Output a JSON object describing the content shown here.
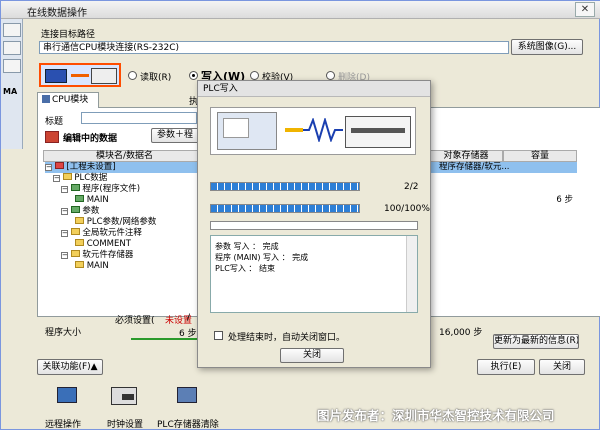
{
  "window": {
    "title": "在线数据操作"
  },
  "left_strip": {
    "label": "MA"
  },
  "connection": {
    "label": "连接目标路径",
    "value": "串行通信CPU模块连接(RS-232C)",
    "button": "系统图像(G)..."
  },
  "modes": [
    {
      "label": "读取(R)",
      "selected": false
    },
    {
      "label": "写入(W)",
      "selected": true
    },
    {
      "label": "校验(V)",
      "selected": false
    },
    {
      "label": "删除(D)",
      "selected": false
    }
  ],
  "tab": {
    "label": "CPU模块",
    "partial_label": "执"
  },
  "title_field": {
    "label": "标题"
  },
  "editing": {
    "label": "编辑中的数据",
    "param_button": "参数＋程"
  },
  "tree": {
    "header": "模块名/数据名",
    "rows": [
      {
        "label": "[工程未设置]",
        "indent": 0,
        "selected": true
      },
      {
        "label": "PLC数据",
        "indent": 1,
        "selected": false
      },
      {
        "label": "程序(程序文件)",
        "indent": 2,
        "selected": false
      },
      {
        "label": "MAIN",
        "indent": 3,
        "selected": false
      },
      {
        "label": "参数",
        "indent": 2,
        "selected": false
      },
      {
        "label": "PLC参数/网络参数",
        "indent": 3,
        "selected": false
      },
      {
        "label": "全局软元件注释",
        "indent": 2,
        "selected": false
      },
      {
        "label": "COMMENT",
        "indent": 3,
        "selected": false
      },
      {
        "label": "软元件存储器",
        "indent": 2,
        "selected": false
      },
      {
        "label": "MAIN",
        "indent": 3,
        "selected": false
      }
    ]
  },
  "right_table": {
    "col1": "对象存储器",
    "col2": "容量",
    "row_memory": "程序存储器/软元...",
    "row_capacity": "6 步"
  },
  "footer": {
    "required_label": "必须设置(",
    "unset_text": "未设置",
    "slash": "/",
    "program_size_label": "程序大小",
    "program_size_value": "6 步",
    "total_steps": "16,000 步",
    "refresh_button": "更新为最新的信息(R)"
  },
  "bottom": {
    "related_button": "关联功能(F)▲",
    "execute_button": "执行(E)",
    "close_button": "关闭",
    "tools": [
      "远程操作",
      "时钟设置",
      "PLC存储器清除"
    ]
  },
  "dialog": {
    "title": "PLC写入",
    "progress1": {
      "label": "2/2",
      "fraction": 1.0
    },
    "progress2": {
      "label": "100/100%",
      "fraction": 1.0
    },
    "progress3": {
      "fraction": 0.0
    },
    "log_lines": [
      "参数 写入 ： 完成",
      "程序 (MAIN) 写入 ： 完成",
      "PLC写入 ： 结束"
    ],
    "auto_close_label": "处理结束时，自动关闭窗口。",
    "close_button": "关闭"
  },
  "watermark": "图片发布者：深圳市华杰智控技术有限公司"
}
